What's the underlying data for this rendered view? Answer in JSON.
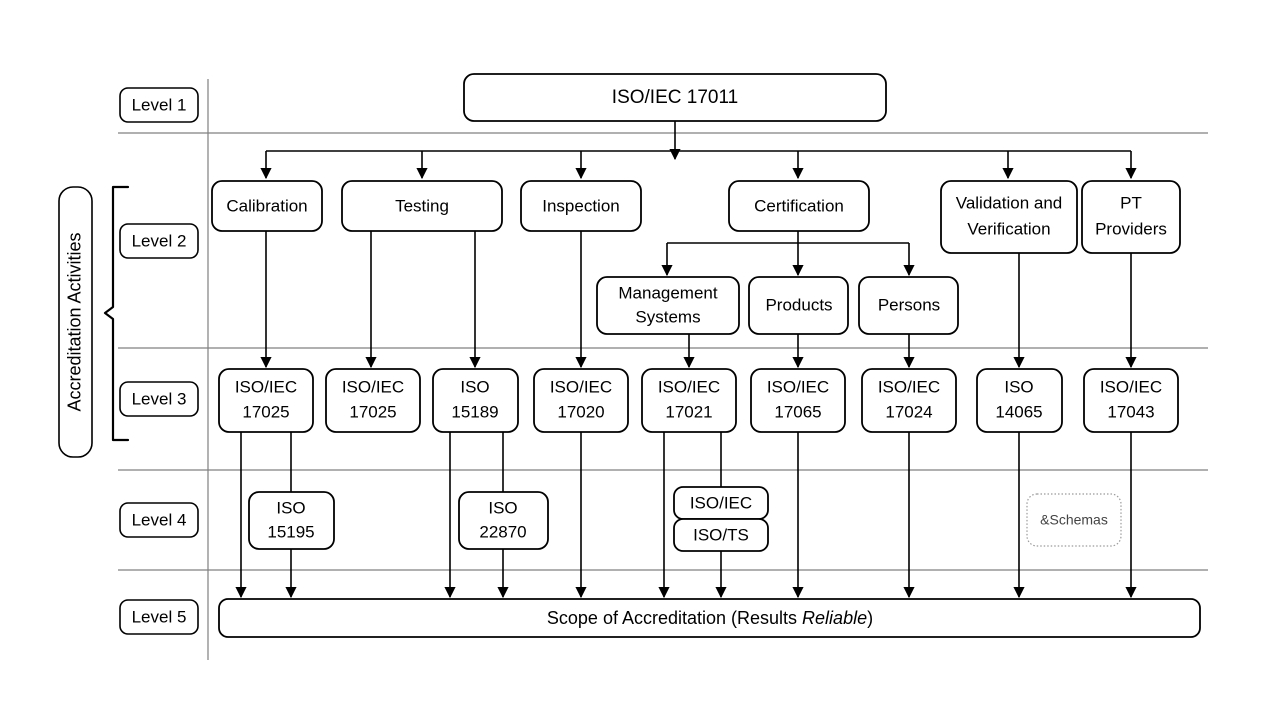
{
  "diagram": {
    "title_implicit": "Accreditation structure",
    "side_label": "Accreditation Activities",
    "colors": {
      "stroke": "#000000",
      "grid": "#808080",
      "faint_stroke": "#aaaaaa",
      "faint_text": "#555555",
      "background": "#ffffff"
    },
    "level_labels": [
      {
        "id": "level1",
        "text": "Level 1"
      },
      {
        "id": "level2",
        "text": "Level 2"
      },
      {
        "id": "level3",
        "text": "Level 3"
      },
      {
        "id": "level4",
        "text": "Level 4"
      },
      {
        "id": "level5",
        "text": "Level 5"
      }
    ],
    "level1": [
      {
        "id": "iso17011",
        "lines": [
          "ISO/IEC 17011"
        ]
      }
    ],
    "level2": [
      {
        "id": "calibration",
        "lines": [
          "Calibration"
        ]
      },
      {
        "id": "testing",
        "lines": [
          "Testing"
        ]
      },
      {
        "id": "inspection",
        "lines": [
          "Inspection"
        ]
      },
      {
        "id": "certification",
        "lines": [
          "Certification"
        ]
      },
      {
        "id": "validation-verification",
        "lines": [
          "Validation and",
          "Verification"
        ]
      },
      {
        "id": "pt-providers",
        "lines": [
          "PT",
          "Providers"
        ]
      }
    ],
    "level2b": [
      {
        "id": "management-systems",
        "lines": [
          "Management",
          "Systems"
        ]
      },
      {
        "id": "products",
        "lines": [
          "Products"
        ]
      },
      {
        "id": "persons",
        "lines": [
          "Persons"
        ]
      }
    ],
    "level3": [
      {
        "id": "iso17025-cal",
        "lines": [
          "ISO/IEC",
          "17025"
        ]
      },
      {
        "id": "iso17025-test",
        "lines": [
          "ISO/IEC",
          "17025"
        ]
      },
      {
        "id": "iso15189",
        "lines": [
          "ISO",
          "15189"
        ]
      },
      {
        "id": "iso17020",
        "lines": [
          "ISO/IEC",
          "17020"
        ]
      },
      {
        "id": "iso17021",
        "lines": [
          "ISO/IEC",
          "17021"
        ]
      },
      {
        "id": "iso17065",
        "lines": [
          "ISO/IEC",
          "17065"
        ]
      },
      {
        "id": "iso17024",
        "lines": [
          "ISO/IEC",
          "17024"
        ]
      },
      {
        "id": "iso14065",
        "lines": [
          "ISO",
          "14065"
        ]
      },
      {
        "id": "iso17043",
        "lines": [
          "ISO/IEC",
          "17043"
        ]
      }
    ],
    "level4": [
      {
        "id": "iso15195",
        "lines": [
          "ISO",
          "15195"
        ]
      },
      {
        "id": "iso22870",
        "lines": [
          "ISO",
          "22870"
        ]
      },
      {
        "id": "isoiec-stack-top",
        "lines": [
          "ISO/IEC"
        ]
      },
      {
        "id": "isots-stack-bottom",
        "lines": [
          "ISO/TS"
        ]
      },
      {
        "id": "schemas",
        "lines": [
          "&Schemas"
        ]
      }
    ],
    "level5": {
      "id": "scope-of-accreditation",
      "text_before": "Scope of Accreditation (Results ",
      "text_italic": "Reliable",
      "text_after": ")"
    }
  }
}
